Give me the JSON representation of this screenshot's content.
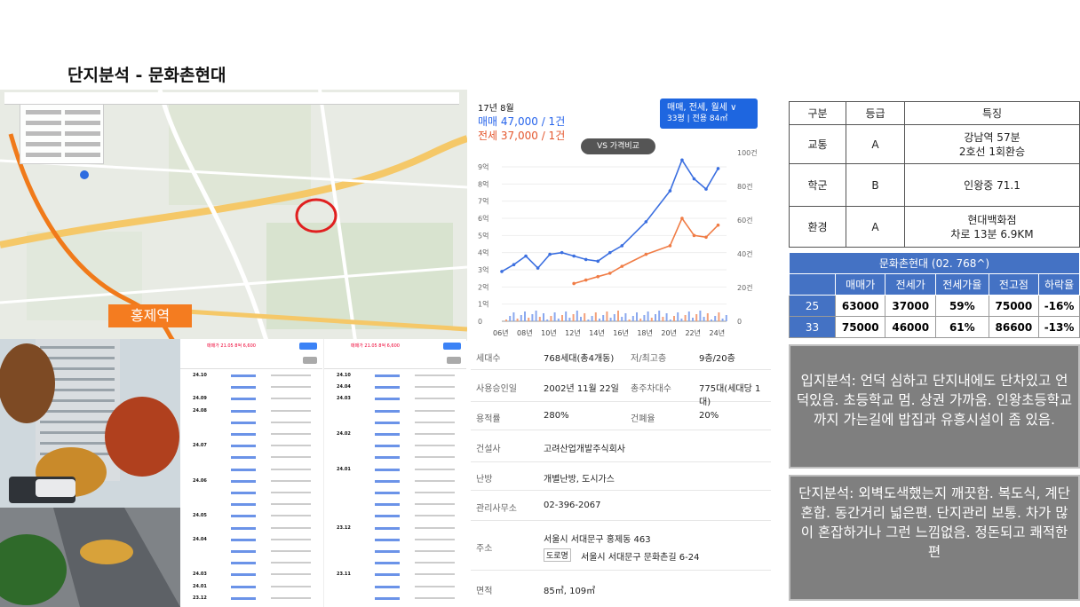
{
  "title": "단지분석  - 문화촌현대",
  "map": {
    "station_label": "홍제역"
  },
  "chart": {
    "date_label": "17년 8월",
    "sale_label": "매매 47,000 / 1건",
    "jeonse_label": "전세 37,000 / 1건",
    "type_button_line1": "매매, 전세, 월세 ∨",
    "type_button_line2": "33평 | 전용 84㎡",
    "vs_button": "VS 가격비교"
  },
  "chart_data": {
    "type": "line",
    "x": [
      "06년",
      "08년",
      "10년",
      "12년",
      "14년",
      "16년",
      "18년",
      "20년",
      "22년",
      "24년"
    ],
    "y_left_ticks": [
      "0",
      "1억",
      "2억",
      "3억",
      "4억",
      "5억",
      "6억",
      "7억",
      "8억",
      "9억"
    ],
    "y_right_ticks": [
      "0",
      "20건",
      "40건",
      "60건",
      "80건",
      "100건"
    ],
    "ylim": [
      0,
      9
    ],
    "series": [
      {
        "name": "매매",
        "color": "#3b6fe0",
        "values": [
          2.9,
          3.3,
          3.8,
          3.1,
          3.9,
          4.0,
          3.8,
          3.6,
          3.5,
          4.0,
          4.4,
          5.8,
          7.6,
          9.4,
          8.3,
          7.7,
          8.9
        ]
      },
      {
        "name": "전세",
        "color": "#f07c45",
        "values": [
          null,
          null,
          null,
          null,
          null,
          null,
          2.2,
          2.4,
          2.6,
          2.8,
          3.2,
          3.9,
          4.4,
          6.0,
          5.0,
          4.9,
          5.6
        ]
      }
    ],
    "x_points": [
      2006,
      2007,
      2008,
      2009,
      2010,
      2011,
      2012,
      2013,
      2014,
      2015,
      2016,
      2018,
      2020,
      2021,
      2022,
      2023,
      2024
    ]
  },
  "grade_table": {
    "headers": [
      "구분",
      "등급",
      "특징"
    ],
    "rows": [
      {
        "category": "교통",
        "grade": "A",
        "feature1": "강남역 57분",
        "feature2": "2호선 1회환승"
      },
      {
        "category": "학군",
        "grade": "B",
        "feature1": "인왕중 71.1",
        "feature2": ""
      },
      {
        "category": "환경",
        "grade": "A",
        "feature1": "현대백화점",
        "feature2": "차로 13분 6.9KM"
      }
    ]
  },
  "price_table": {
    "title": "문화촌현대 (02. 768^)",
    "headers": [
      "매매가",
      "전세가",
      "전세가율",
      "전고점",
      "하락율"
    ],
    "rows": [
      {
        "type": "25",
        "sale": "63000",
        "jeonse": "37000",
        "ratio": "59%",
        "peak": "75000",
        "drop": "-16%"
      },
      {
        "type": "33",
        "sale": "75000",
        "jeonse": "46000",
        "ratio": "61%",
        "peak": "86600",
        "drop": "-13%"
      }
    ]
  },
  "notes": {
    "location": "입지분석: 언덕 심하고 단지내에도 단차있고 언덕있음. 초등학교 멈. 상권 가까움. 인왕초등학교까지 가는길에 밥집과 유흥시설이 좀 있음.",
    "complex": "단지분석: 외벽도색했는지 깨끗함. 복도식, 계단혼합. 동간거리 넓은편. 단지관리 보통. 차가 많이 혼잡하거나 그런 느낌없음. 정돈되고 쾌적한 편"
  },
  "info": {
    "households_label": "세대수",
    "households": "768세대(총4개동)",
    "floors_label": "저/최고층",
    "floors": "9층/20층",
    "approval_label": "사용승인일",
    "approval": "2002년 11월 22일",
    "parking_label": "총주차대수",
    "parking": "775대(세대당 1대)",
    "far_label": "용적률",
    "far": "280%",
    "bcr_label": "건폐율",
    "bcr": "20%",
    "builder_label": "건설사",
    "builder": "고려산업개발주식회사",
    "heating_label": "난방",
    "heating": "개별난방, 도시가스",
    "office_label": "관리사무소",
    "office": "02-396-2067",
    "address_label": "주소",
    "address": "서울시 서대문구 홍제동 463",
    "road_tag": "도로명",
    "road_address": "서울시 서대문구 문화촌길 6-24",
    "area_label": "면적",
    "area": "85㎡, 109㎡"
  },
  "transactions": {
    "left_header": "매매가 21.05 8억 6,600",
    "right_header": "매매가 21.05 8억 6,600",
    "left_dates": [
      "24.10",
      "",
      "24.09",
      "24.08",
      "",
      "",
      "24.07",
      "",
      "",
      "24.06",
      "",
      "",
      "24.05",
      "",
      "24.04",
      "",
      "",
      "24.03",
      "24.01",
      "23.12"
    ],
    "right_dates": [
      "24.10",
      "24.04",
      "24.03",
      "",
      "",
      "24.02",
      "",
      "",
      "24.01",
      "",
      "",
      "",
      "",
      "23.12",
      "",
      "",
      "",
      "23.11",
      "",
      ""
    ]
  }
}
